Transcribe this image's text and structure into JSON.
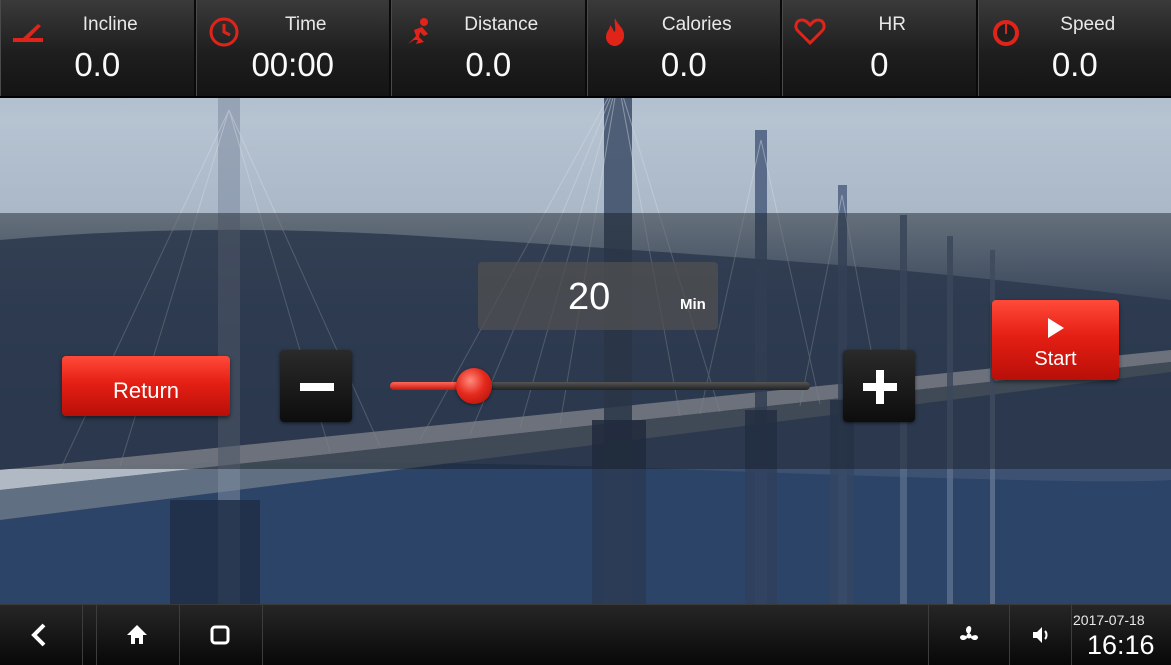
{
  "stats": [
    {
      "label": "Incline",
      "value": "0.0",
      "icon": "incline-icon"
    },
    {
      "label": "Time",
      "value": "00:00",
      "icon": "clock-icon"
    },
    {
      "label": "Distance",
      "value": "0.0",
      "icon": "runner-icon"
    },
    {
      "label": "Calories",
      "value": "0.0",
      "icon": "flame-icon"
    },
    {
      "label": "HR",
      "value": "0",
      "icon": "heart-icon"
    },
    {
      "label": "Speed",
      "value": "0.0",
      "icon": "speedometer-icon"
    }
  ],
  "time_setting": {
    "value": "20",
    "unit": "Min",
    "slider_fraction": 0.2
  },
  "buttons": {
    "return_label": "Return",
    "start_label": "Start"
  },
  "navbar": {
    "date": "2017-07-18",
    "time": "16:16",
    "icons": [
      "back-icon",
      "home-icon",
      "recent-apps-icon",
      "fan-icon",
      "volume-icon"
    ]
  },
  "colors": {
    "accent": "#e51f14",
    "icon_red": "#e0241a"
  }
}
